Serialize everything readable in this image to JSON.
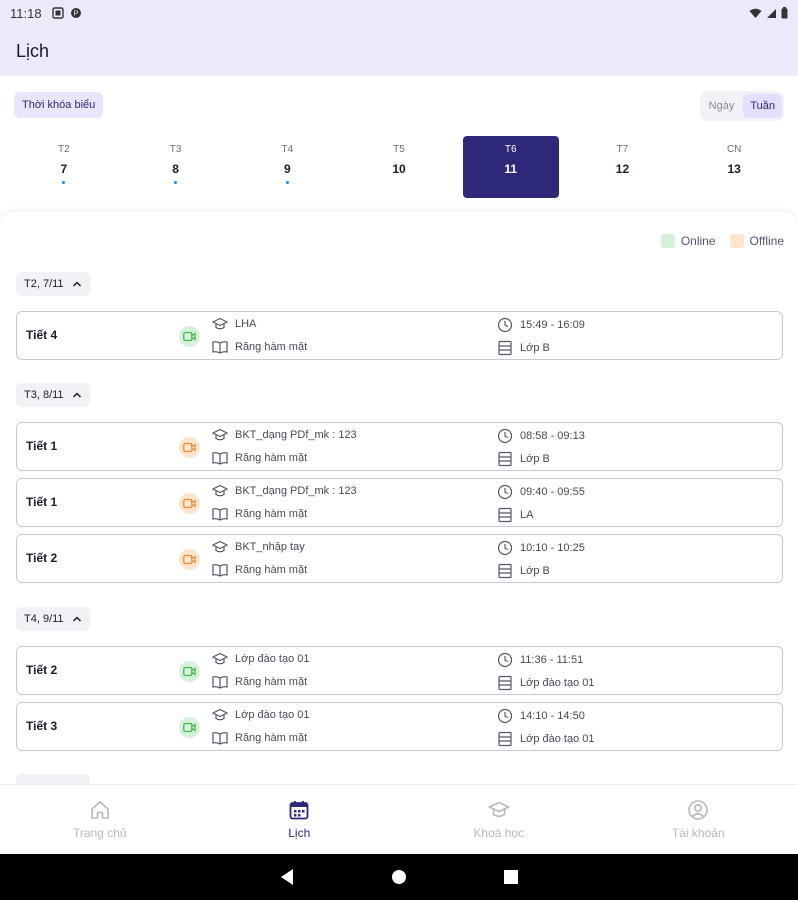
{
  "status_bar": {
    "time": "11:18"
  },
  "app_bar": {
    "title": "Lịch"
  },
  "controls": {
    "schedule_chip": "Thời khóa biểu",
    "view_toggle": [
      {
        "label": "Ngày",
        "active": false
      },
      {
        "label": "Tuần",
        "active": true
      }
    ]
  },
  "week": [
    {
      "name": "T2",
      "date": "7",
      "has_dot": true,
      "selected": false
    },
    {
      "name": "T3",
      "date": "8",
      "has_dot": true,
      "selected": false
    },
    {
      "name": "T4",
      "date": "9",
      "has_dot": true,
      "selected": false
    },
    {
      "name": "T5",
      "date": "10",
      "has_dot": false,
      "selected": false
    },
    {
      "name": "T6",
      "date": "11",
      "has_dot": false,
      "selected": true
    },
    {
      "name": "T7",
      "date": "12",
      "has_dot": false,
      "selected": false
    },
    {
      "name": "CN",
      "date": "13",
      "has_dot": false,
      "selected": false
    }
  ],
  "legend": {
    "online": {
      "label": "Online",
      "color": "#d6f0dc"
    },
    "offline": {
      "label": "Offline",
      "color": "#fde4cc"
    }
  },
  "groups": [
    {
      "header": "T2, 7/11",
      "lessons": [
        {
          "period": "Tiết 4",
          "mode": "online",
          "class_name": "LHA",
          "subject": "Răng hàm mặt",
          "time": "15:49 - 16:09",
          "room": "Lớp B"
        }
      ]
    },
    {
      "header": "T3, 8/11",
      "lessons": [
        {
          "period": "Tiết 1",
          "mode": "offline",
          "class_name": "BKT_dạng PDf_mk : 123",
          "subject": "Răng hàm mặt",
          "time": "08:58 - 09:13",
          "room": "Lớp B"
        },
        {
          "period": "Tiết 1",
          "mode": "offline",
          "class_name": "BKT_dạng PDf_mk : 123",
          "subject": "Răng hàm mặt",
          "time": "09:40 - 09:55",
          "room": "LA"
        },
        {
          "period": "Tiết 2",
          "mode": "offline",
          "class_name": "BKT_nhập tay",
          "subject": "Răng hàm mặt",
          "time": "10:10 - 10:25",
          "room": "Lớp B"
        }
      ]
    },
    {
      "header": "T4, 9/11",
      "lessons": [
        {
          "period": "Tiết 2",
          "mode": "online",
          "class_name": "Lớp đào tạo 01",
          "subject": "Răng hàm mặt",
          "time": "11:36 - 11:51",
          "room": "Lớp đào tạo 01"
        },
        {
          "period": "Tiết 3",
          "mode": "online",
          "class_name": "Lớp đào tạo 01",
          "subject": "Răng hàm mặt",
          "time": "14:10 - 14:50",
          "room": "Lớp đào tạo 01"
        }
      ]
    }
  ],
  "bottom_nav": [
    {
      "label": "Trang chủ",
      "icon": "home-icon",
      "active": false
    },
    {
      "label": "Lịch",
      "icon": "calendar-icon",
      "active": true
    },
    {
      "label": "Khoá học",
      "icon": "graduation-cap-icon",
      "active": false
    },
    {
      "label": "Tài khoản",
      "icon": "account-icon",
      "active": false
    }
  ],
  "colors": {
    "accent": "#2e2878",
    "online": "#4caf50",
    "offline": "#f08a3c"
  }
}
